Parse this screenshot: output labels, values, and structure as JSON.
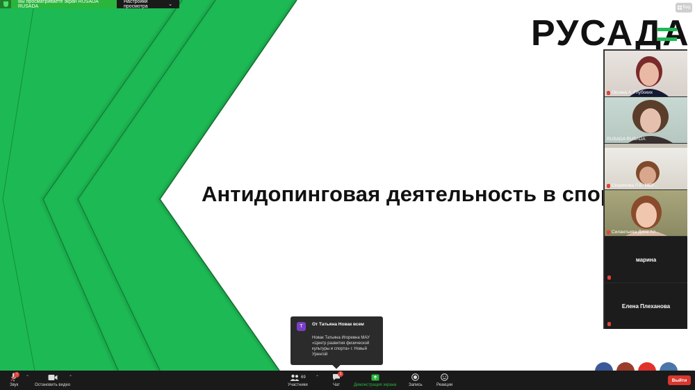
{
  "share_banner": {
    "message": "Вы просматриваете экран RUSADA RUSADA",
    "view_options": "Настройки просмотра"
  },
  "view_button": {
    "label": "Вид"
  },
  "slide": {
    "logo_text": "РУСАДА",
    "title": "Антидопинговая деятельность в спор"
  },
  "participants": [
    {
      "name": "Оксана А. Глубоких",
      "video": true
    },
    {
      "name": "RUSADA RUSADA",
      "video": true
    },
    {
      "name": "Скорикова Л.Б. МБУ...",
      "video": true
    },
    {
      "name": "Силантьева Дина Ал...",
      "video": true
    },
    {
      "name": "марина",
      "video": false
    },
    {
      "name": "Елена Плеханова",
      "video": false
    }
  ],
  "chat_toast": {
    "avatar_letter": "Т",
    "from": "От Татьяна Новак всем",
    "message": "Новак Татьяна Игоревна МАУ «Центр развития физической культуры и спорта» г. Новый Уренгой"
  },
  "toolbar": {
    "audio_label": "Звук",
    "video_label": "Остановить видео",
    "participants_label": "Участники",
    "participants_count": "69",
    "chat_label": "Чат",
    "chat_badge": "1",
    "share_label": "Демонстрация экрана",
    "record_label": "Запись",
    "reactions_label": "Реакции",
    "leave_label": "Выйти"
  },
  "colors": {
    "brand_green": "#1db954",
    "share_green": "#2ab53c",
    "leave_red": "#d9372f",
    "toolbar_bg": "#1a1a1a"
  }
}
